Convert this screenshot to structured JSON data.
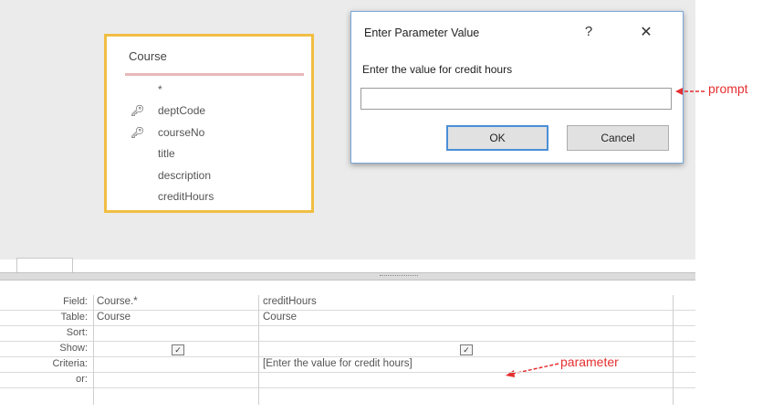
{
  "table": {
    "title": "Course",
    "fields": [
      {
        "name": "*",
        "key": false
      },
      {
        "name": "deptCode",
        "key": true
      },
      {
        "name": "courseNo",
        "key": true
      },
      {
        "name": "title",
        "key": false
      },
      {
        "name": "description",
        "key": false
      },
      {
        "name": "creditHours",
        "key": false
      }
    ]
  },
  "dialog": {
    "title": "Enter Parameter Value",
    "help_glyph": "?",
    "close_glyph": "✕",
    "prompt": "Enter the value for credit hours",
    "input_value": "",
    "ok_label": "OK",
    "cancel_label": "Cancel"
  },
  "annotations": {
    "prompt": "prompt",
    "parameter": "parameter",
    "color": "#e53030"
  },
  "grid": {
    "row_labels": [
      "Field:",
      "Table:",
      "Sort:",
      "Show:",
      "Criteria:",
      "or:"
    ],
    "columns": [
      {
        "field": "Course.*",
        "table": "Course",
        "sort": "",
        "show": true,
        "criteria": "",
        "or": ""
      },
      {
        "field": "creditHours",
        "table": "Course",
        "sort": "",
        "show": true,
        "criteria": "[Enter the value for credit hours]",
        "or": ""
      }
    ]
  },
  "icons": {
    "key": "primary-key-icon",
    "checkbox": "checkbox-checked-icon"
  }
}
